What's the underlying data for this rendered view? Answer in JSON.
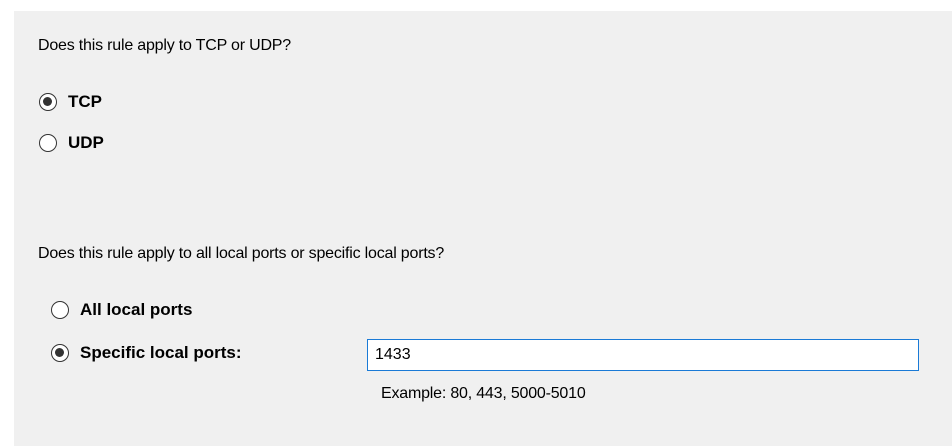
{
  "protocol_section": {
    "question": "Does this rule apply to TCP or UDP?",
    "options": [
      {
        "label": "TCP",
        "checked": true
      },
      {
        "label": "UDP",
        "checked": false
      }
    ]
  },
  "ports_section": {
    "question": "Does this rule apply to all local ports or specific local ports?",
    "options": [
      {
        "label": "All local ports",
        "checked": false
      },
      {
        "label": "Specific local ports:",
        "checked": true
      }
    ],
    "ports_value": "1433",
    "example": "Example: 80, 443, 5000-5010"
  },
  "colors": {
    "background": "#f0f0f0",
    "input_border_focus": "#1a7ad6"
  }
}
